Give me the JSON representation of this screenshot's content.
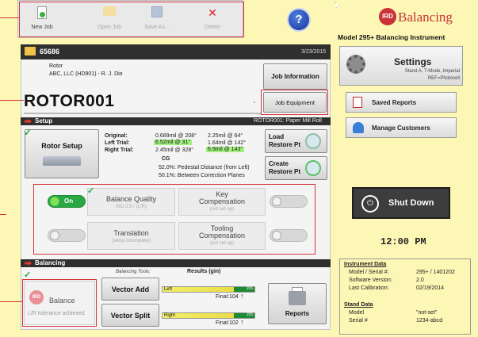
{
  "toolbar": {
    "new_job": "New Job",
    "open_job": "Open Job",
    "save_as": "Save As...",
    "delete": "Delete",
    "help": "?"
  },
  "brand": {
    "logo_text": "IRD",
    "logo_word": "Balancing",
    "model": "Model 295+ Balancing Instrument"
  },
  "job": {
    "number": "65686",
    "date": "3/23/2015",
    "type": "Rotor",
    "customer": "ABC, LLC  (HD901)  -  R. J. Dio",
    "info_button": "Job Information",
    "rotor_name": "ROTOR001",
    "equipment_button": "Job Equipment"
  },
  "setup": {
    "title": "Setup",
    "rotor_ref": "ROTOR001: Paper Mill Roll",
    "rotor_setup_button": "Rotor Setup",
    "original_label": "Original:",
    "original_v1": "0.689mil @ 208°",
    "original_v2": "2.25mil @ 64°",
    "left_label": "Left Trial:",
    "left_v1": "6.52mil @ 31°",
    "left_v2": "1.64mil @ 142°",
    "right_label": "Right Trial:",
    "right_v1": "2.45mil @ 328°",
    "right_v2": "6.9mil @ 143°",
    "cg_label": "CG",
    "pct1": "52.0%",
    "pct1_text": ": Pedestal Distance (from Left)",
    "pct2": "50.1%",
    "pct2_text": ": Between Correction Planes",
    "load_button": "Load Restore Pt",
    "create_button": "Create Restore Pt"
  },
  "options": {
    "balance_quality": {
      "title": "Balance Quality",
      "sub": "ISO 2.5 / (L/R)",
      "toggle": "On",
      "level": 1
    },
    "key_comp": {
      "title": "Key Compensation",
      "sub": "(not set up)"
    },
    "translation": {
      "title": "Translation",
      "sub": "(setup incomplete)"
    },
    "tooling_comp": {
      "title": "Tooling Compensation",
      "sub": "(not set up)"
    }
  },
  "balancing": {
    "title": "Balancing",
    "tools_label": "Balancing Tools:",
    "results_label": "Results (gin)",
    "vector_add": "Vector Add",
    "vector_split": "Vector Split",
    "left_label": "Left",
    "left_max": "155",
    "left_final": "Final:104",
    "right_label": "Right",
    "right_max": "155",
    "right_final": "Final:102",
    "reports": "Reports",
    "balance_btn": "Balance",
    "balance_status": "L/R tolerance achieved"
  },
  "right_panel": {
    "settings_title": "Settings",
    "settings_sub1": "Stand A, T-Mode, Imperial",
    "settings_sub2": "REF=Photocell",
    "saved_reports": "Saved Reports",
    "manage_customers": "Manage Customers",
    "shutdown": "Shut Down",
    "clock": "12:00 PM"
  },
  "instrument": {
    "title": "Instrument Data",
    "model_label": "Model / Serial #:",
    "model_value": "295+ / 1401202",
    "sw_label": "Software Version:",
    "sw_value": "2.0",
    "cal_label": "Last Calibration:",
    "cal_value": "02/19/2014",
    "stand_title": "Stand Data",
    "stand_model_label": "Model",
    "stand_model_value": "\"not-set\"",
    "serial_label": "Serial #",
    "serial_value": "1234-abcd"
  },
  "colors": {
    "background": "#fdf7b5",
    "accent_red": "#d5343a",
    "section_bar": "#2f2f2f",
    "green": "#29a745"
  }
}
